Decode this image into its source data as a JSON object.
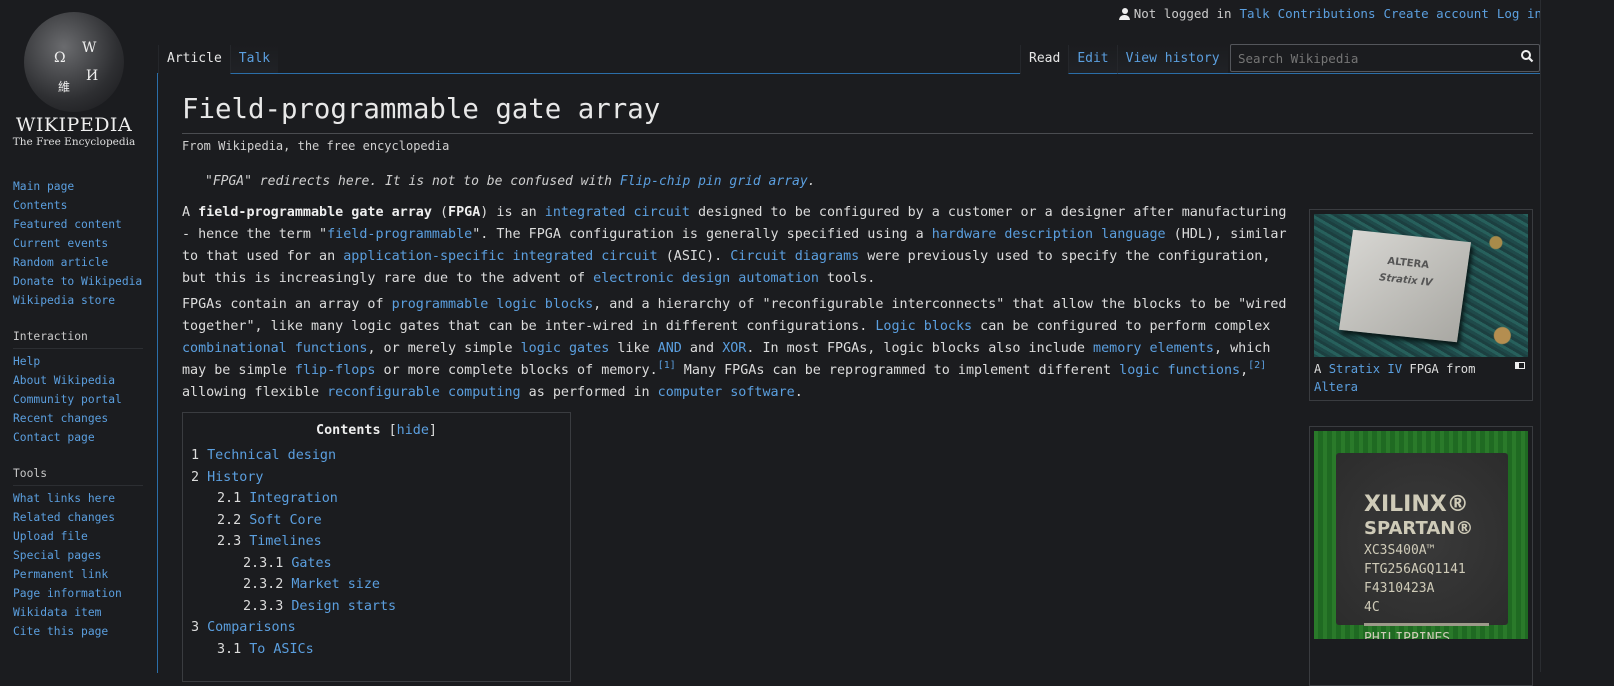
{
  "logo": {
    "wordmark": "WIKIPEDIA",
    "tagline": "The Free Encyclopedia"
  },
  "personal": {
    "status": "Not logged in",
    "links": [
      "Talk",
      "Contributions",
      "Create account",
      "Log in"
    ]
  },
  "tabs": {
    "left": [
      "Article",
      "Talk"
    ],
    "right": [
      "Read",
      "Edit",
      "View history"
    ]
  },
  "search": {
    "placeholder": "Search Wikipedia"
  },
  "sidebar": {
    "navigation": [
      "Main page",
      "Contents",
      "Featured content",
      "Current events",
      "Random article",
      "Donate to Wikipedia",
      "Wikipedia store"
    ],
    "interaction_heading": "Interaction",
    "interaction": [
      "Help",
      "About Wikipedia",
      "Community portal",
      "Recent changes",
      "Contact page"
    ],
    "tools_heading": "Tools",
    "tools": [
      "What links here",
      "Related changes",
      "Upload file",
      "Special pages",
      "Permanent link",
      "Page information",
      "Wikidata item",
      "Cite this page"
    ]
  },
  "article": {
    "title": "Field-programmable gate array",
    "site_sub": "From Wikipedia, the free encyclopedia",
    "hatnote": {
      "text": "\"FPGA\" redirects here. It is not to be confused with ",
      "link": "Flip-chip pin grid array",
      "end": "."
    },
    "paragraphs": [
      [
        {
          "t": "A "
        },
        {
          "t": "field-programmable gate array",
          "b": 1
        },
        {
          "t": " ("
        },
        {
          "t": "FPGA",
          "b": 1
        },
        {
          "t": ") is an "
        },
        {
          "t": "integrated circuit",
          "l": 1
        },
        {
          "t": " designed to be configured by a customer or a designer after manufacturing - hence the term \""
        },
        {
          "t": "field-programmable",
          "l": 1
        },
        {
          "t": "\". The FPGA configuration is generally specified using a "
        },
        {
          "t": "hardware description language",
          "l": 1
        },
        {
          "t": " (HDL), similar to that used for an "
        },
        {
          "t": "application-specific integrated circuit",
          "l": 1
        },
        {
          "t": " (ASIC). "
        },
        {
          "t": "Circuit diagrams",
          "l": 1
        },
        {
          "t": " were previously used to specify the configuration, but this is increasingly rare due to the advent of "
        },
        {
          "t": "electronic design automation",
          "l": 1
        },
        {
          "t": " tools."
        }
      ],
      [
        {
          "t": "FPGAs contain an array of "
        },
        {
          "t": "programmable logic blocks",
          "l": 1
        },
        {
          "t": ", and a hierarchy of \"reconfigurable interconnects\" that allow the blocks to be \"wired together\", like many logic gates that can be inter-wired in different configurations. "
        },
        {
          "t": "Logic blocks",
          "l": 1
        },
        {
          "t": " can be configured to perform complex "
        },
        {
          "t": "combinational functions",
          "l": 1
        },
        {
          "t": ", or merely simple "
        },
        {
          "t": "logic gates",
          "l": 1
        },
        {
          "t": " like "
        },
        {
          "t": "AND",
          "l": 1
        },
        {
          "t": " and "
        },
        {
          "t": "XOR",
          "l": 1
        },
        {
          "t": ". In most FPGAs, logic blocks also include "
        },
        {
          "t": "memory elements",
          "l": 1
        },
        {
          "t": ", which may be simple "
        },
        {
          "t": "flip-flops",
          "l": 1
        },
        {
          "t": " or more complete blocks of memory."
        },
        {
          "t": "[1]",
          "s": 1
        },
        {
          "t": " Many FPGAs can be reprogrammed to implement different "
        },
        {
          "t": "logic functions",
          "l": 1
        },
        {
          "t": ",",
          "n": 1
        },
        {
          "t": "[2]",
          "s": 1
        },
        {
          "t": " allowing flexible "
        },
        {
          "t": "reconfigurable computing",
          "l": 1
        },
        {
          "t": " as performed in "
        },
        {
          "t": "computer software",
          "l": 1
        },
        {
          "t": "."
        }
      ]
    ]
  },
  "toc": {
    "title": "Contents",
    "hide": "hide",
    "items": [
      {
        "n": "1",
        "t": "Technical design",
        "lvl": 0
      },
      {
        "n": "2",
        "t": "History",
        "lvl": 0
      },
      {
        "n": "2.1",
        "t": "Integration",
        "lvl": 1
      },
      {
        "n": "2.2",
        "t": "Soft Core",
        "lvl": 1
      },
      {
        "n": "2.3",
        "t": "Timelines",
        "lvl": 1
      },
      {
        "n": "2.3.1",
        "t": "Gates",
        "lvl": 2
      },
      {
        "n": "2.3.2",
        "t": "Market size",
        "lvl": 2
      },
      {
        "n": "2.3.3",
        "t": "Design starts",
        "lvl": 2
      },
      {
        "n": "3",
        "t": "Comparisons",
        "lvl": 0
      },
      {
        "n": "3.1",
        "t": "To ASICs",
        "lvl": 1
      }
    ]
  },
  "thumbs": [
    {
      "caption_pre": "A ",
      "link1": "Stratix IV",
      "caption_mid": " FPGA from ",
      "link2": "Altera",
      "chip_brand": "ALTERA",
      "chip_line": "Stratix IV"
    },
    {
      "chip_lines": [
        "XILINX®",
        "SPARTAN®",
        "XC3S400A™",
        "FTG256AGQ1141",
        "F4310423A",
        "4C",
        "PHILIPPINES"
      ]
    }
  ]
}
